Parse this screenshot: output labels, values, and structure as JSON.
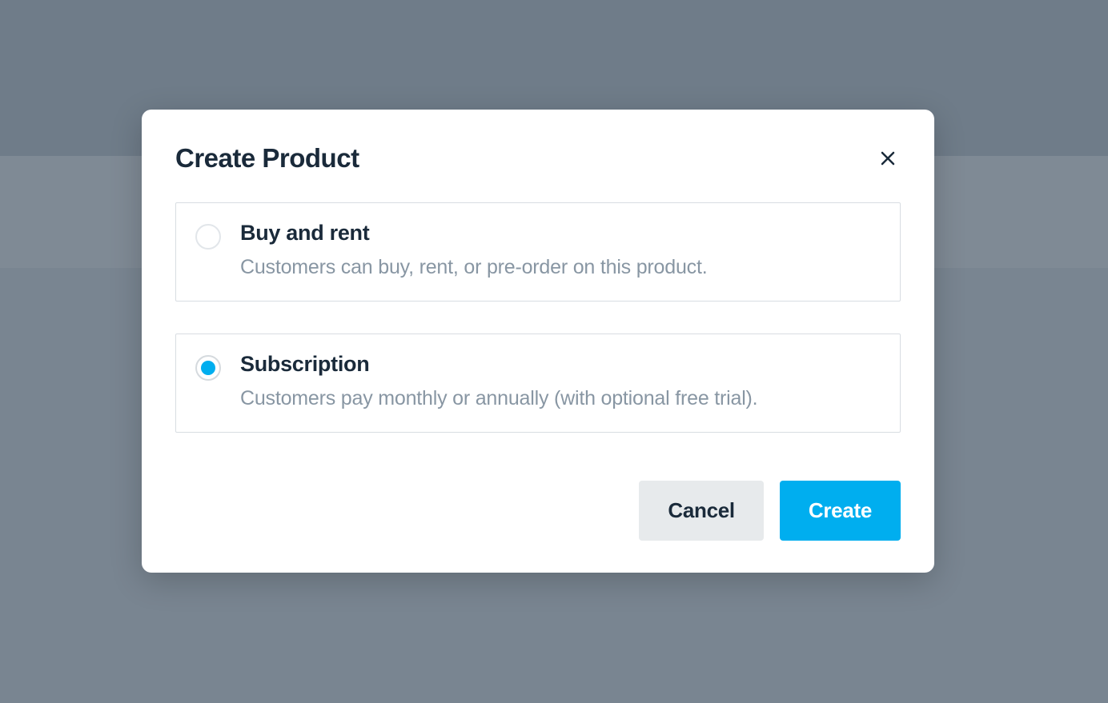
{
  "modal": {
    "title": "Create Product",
    "options": [
      {
        "title": "Buy and rent",
        "description": "Customers can buy, rent, or pre-order on this product.",
        "selected": false
      },
      {
        "title": "Subscription",
        "description": "Customers pay monthly or annually (with optional free trial).",
        "selected": true
      }
    ],
    "buttons": {
      "cancel": "Cancel",
      "create": "Create"
    }
  }
}
